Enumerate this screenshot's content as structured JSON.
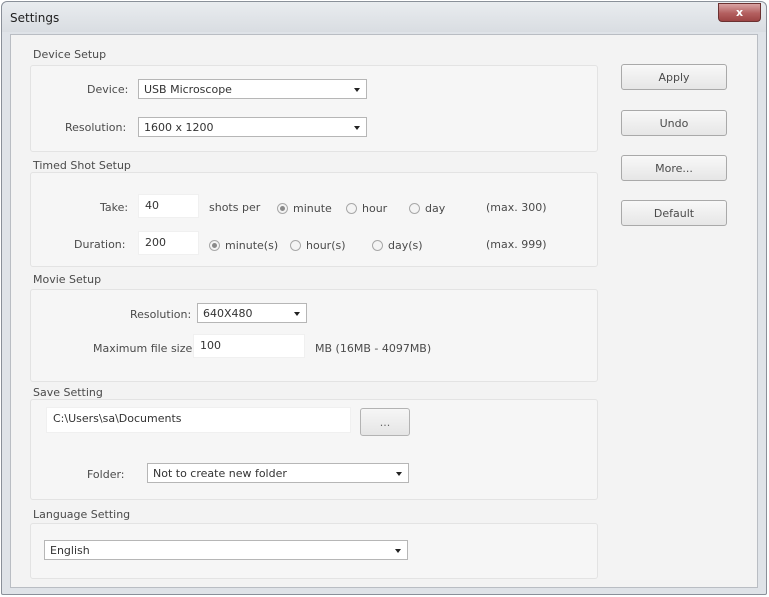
{
  "window": {
    "title": "Settings",
    "close_glyph": "x"
  },
  "device_setup": {
    "title": "Device Setup",
    "device_label": "Device:",
    "device_value": "USB Microscope",
    "resolution_label": "Resolution:",
    "resolution_value": "1600 x 1200"
  },
  "timed_shot": {
    "title": "Timed Shot Setup",
    "take_label": "Take:",
    "take_value": "40",
    "shots_per_label": "shots per",
    "take_units": [
      {
        "label": "minute",
        "checked": true
      },
      {
        "label": "hour",
        "checked": false
      },
      {
        "label": "day",
        "checked": false
      }
    ],
    "take_max": "(max. 300)",
    "duration_label": "Duration:",
    "duration_value": "200",
    "duration_units": [
      {
        "label": "minute(s)",
        "checked": true
      },
      {
        "label": "hour(s)",
        "checked": false
      },
      {
        "label": "day(s)",
        "checked": false
      }
    ],
    "duration_max": "(max. 999)"
  },
  "movie_setup": {
    "title": "Movie Setup",
    "resolution_label": "Resolution:",
    "resolution_value": "640X480",
    "max_file_label": "Maximum file size:",
    "max_file_value": "100",
    "max_file_hint": "MB (16MB - 4097MB)"
  },
  "save_setting": {
    "title": "Save Setting",
    "path_value": "C:\\Users\\sa\\Documents",
    "browse_label": "...",
    "folder_label": "Folder:",
    "folder_value": "Not to create new folder"
  },
  "language_setting": {
    "title": "Language Setting",
    "language_value": "English"
  },
  "buttons": {
    "apply": "Apply",
    "undo": "Undo",
    "more": "More...",
    "default": "Default"
  }
}
